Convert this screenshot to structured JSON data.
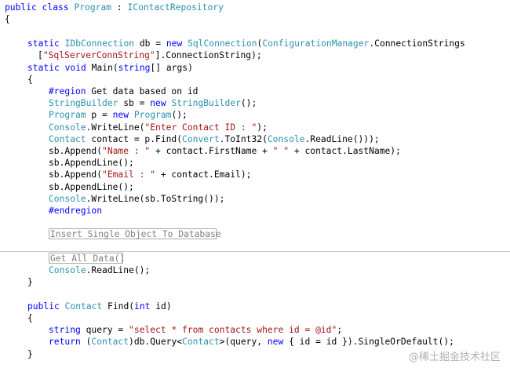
{
  "code": {
    "lines": [
      {
        "tokens": [
          [
            "kw",
            "public"
          ],
          [
            "pl",
            " "
          ],
          [
            "kw",
            "class"
          ],
          [
            "pl",
            " "
          ],
          [
            "ty",
            "Program"
          ],
          [
            "pl",
            " : "
          ],
          [
            "ty",
            "IContactRepository"
          ]
        ]
      },
      {
        "tokens": [
          [
            "pl",
            "{"
          ]
        ]
      },
      {
        "tokens": [
          [
            "kw",
            "static"
          ],
          [
            "pl",
            " "
          ],
          [
            "ty",
            "IDbConnection"
          ],
          [
            "pl",
            " db = "
          ],
          [
            "kw",
            "new"
          ],
          [
            "pl",
            " "
          ],
          [
            "ty",
            "SqlConnection"
          ],
          [
            "pl",
            "("
          ],
          [
            "ty",
            "ConfigurationManager"
          ],
          [
            "pl",
            ".ConnectionStrings"
          ]
        ]
      },
      {
        "tokens": [
          [
            "pl",
            "["
          ],
          [
            "st",
            "\"SqlServerConnString\""
          ],
          [
            "pl",
            "].ConnectionString);"
          ]
        ]
      },
      {
        "tokens": [
          [
            "kw",
            "static"
          ],
          [
            "pl",
            " "
          ],
          [
            "kw",
            "void"
          ],
          [
            "pl",
            " Main("
          ],
          [
            "kw",
            "string"
          ],
          [
            "pl",
            "[] args)"
          ]
        ]
      },
      {
        "tokens": [
          [
            "pl",
            "{"
          ]
        ]
      },
      {
        "tokens": [
          [
            "kw",
            "#region"
          ],
          [
            "pl",
            " Get data based on id"
          ]
        ]
      },
      {
        "tokens": [
          [
            "ty",
            "StringBuilder"
          ],
          [
            "pl",
            " sb = "
          ],
          [
            "kw",
            "new"
          ],
          [
            "pl",
            " "
          ],
          [
            "ty",
            "StringBuilder"
          ],
          [
            "pl",
            "();"
          ]
        ]
      },
      {
        "tokens": [
          [
            "ty",
            "Program"
          ],
          [
            "pl",
            " p = "
          ],
          [
            "kw",
            "new"
          ],
          [
            "pl",
            " "
          ],
          [
            "ty",
            "Program"
          ],
          [
            "pl",
            "();"
          ]
        ]
      },
      {
        "tokens": [
          [
            "ty",
            "Console"
          ],
          [
            "pl",
            ".WriteLine("
          ],
          [
            "st",
            "\"Enter Contact ID : \""
          ],
          [
            "pl",
            ");"
          ]
        ]
      },
      {
        "tokens": [
          [
            "ty",
            "Contact"
          ],
          [
            "pl",
            " contact = p.Find("
          ],
          [
            "ty",
            "Convert"
          ],
          [
            "pl",
            ".ToInt32("
          ],
          [
            "ty",
            "Console"
          ],
          [
            "pl",
            ".ReadLine()));"
          ]
        ]
      },
      {
        "tokens": [
          [
            "pl",
            "sb.Append("
          ],
          [
            "st",
            "\"Name : \""
          ],
          [
            "pl",
            " + contact.FirstName + "
          ],
          [
            "st",
            "\" \""
          ],
          [
            "pl",
            " + contact.LastName);"
          ]
        ]
      },
      {
        "tokens": [
          [
            "pl",
            "sb.AppendLine();"
          ]
        ]
      },
      {
        "tokens": [
          [
            "pl",
            "sb.Append("
          ],
          [
            "st",
            "\"Email : \""
          ],
          [
            "pl",
            " + contact.Email);"
          ]
        ]
      },
      {
        "tokens": [
          [
            "pl",
            "sb.AppendLine();"
          ]
        ]
      },
      {
        "tokens": [
          [
            "ty",
            "Console"
          ],
          [
            "pl",
            ".WriteLine(sb.ToString());"
          ]
        ]
      },
      {
        "tokens": [
          [
            "kw",
            "#endregion"
          ]
        ]
      },
      {
        "tokens": [
          [
            "ty",
            "Console"
          ],
          [
            "pl",
            ".ReadLine();"
          ]
        ]
      },
      {
        "tokens": [
          [
            "pl",
            "}"
          ]
        ]
      },
      {
        "tokens": [
          [
            "kw",
            "public"
          ],
          [
            "pl",
            " "
          ],
          [
            "ty",
            "Contact"
          ],
          [
            "pl",
            " Find("
          ],
          [
            "kw",
            "int"
          ],
          [
            "pl",
            " id)"
          ]
        ]
      },
      {
        "tokens": [
          [
            "pl",
            "{"
          ]
        ]
      },
      {
        "tokens": [
          [
            "kw",
            "string"
          ],
          [
            "pl",
            " query = "
          ],
          [
            "st",
            "\"select * from contacts where id = @id\""
          ],
          [
            "pl",
            ";"
          ]
        ]
      },
      {
        "tokens": [
          [
            "kw",
            "return"
          ],
          [
            "pl",
            " ("
          ],
          [
            "ty",
            "Contact"
          ],
          [
            "pl",
            ")db.Query<"
          ],
          [
            "ty",
            "Contact"
          ],
          [
            "pl",
            ">(query, "
          ],
          [
            "kw",
            "new"
          ],
          [
            "pl",
            " { id = id }).SingleOrDefault();"
          ]
        ]
      },
      {
        "tokens": [
          [
            "pl",
            "}"
          ]
        ]
      }
    ],
    "collapsed_regions": [
      "Insert Single Object To Database",
      "Get All Data()"
    ]
  },
  "watermark": {
    "text": "@稀土掘金技术社区"
  },
  "colors": {
    "keyword": "#0000ff",
    "type": "#2b91af",
    "string": "#a31515",
    "plain": "#000000",
    "collapsed_region": "#808080"
  }
}
